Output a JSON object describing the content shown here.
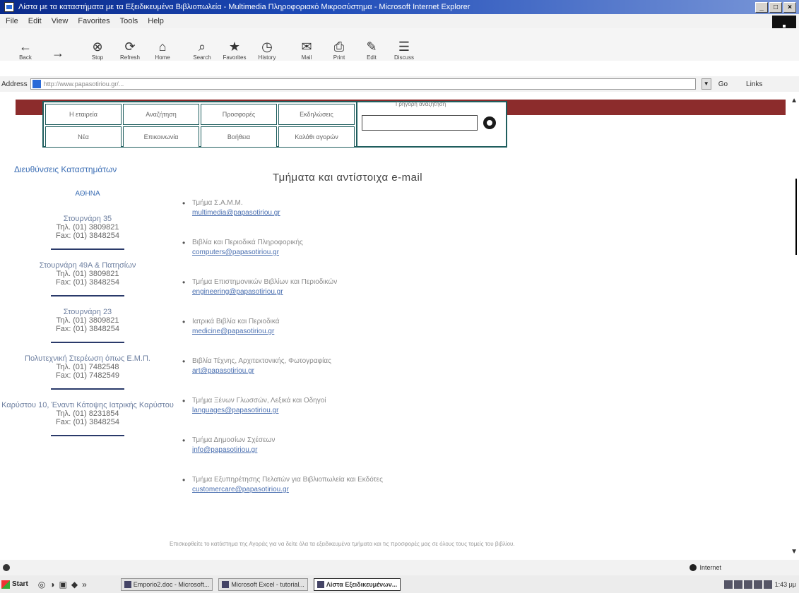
{
  "window": {
    "title": "Λίστα με τα καταστήματα με τα Εξειδικευμένα Βιβλιοπωλεία - Multimedia Πληροφοριακό Μικροσύστημα - Microsoft Internet Explorer",
    "btn_min": "_",
    "btn_max": "□",
    "btn_close": "×"
  },
  "menu": [
    "File",
    "Edit",
    "View",
    "Favorites",
    "Tools",
    "Help"
  ],
  "toolbar": [
    {
      "label": "Back",
      "glyph": "←"
    },
    {
      "label": "",
      "glyph": "→"
    },
    {
      "label": "Stop",
      "glyph": "⊗"
    },
    {
      "label": "Refresh",
      "glyph": "⟳"
    },
    {
      "label": "Home",
      "glyph": "⌂"
    },
    {
      "label": "Search",
      "glyph": "⌕"
    },
    {
      "label": "Favorites",
      "glyph": "★"
    },
    {
      "label": "History",
      "glyph": "◷"
    },
    {
      "label": "Mail",
      "glyph": "✉"
    },
    {
      "label": "Print",
      "glyph": "⎙"
    },
    {
      "label": "Edit",
      "glyph": "✎"
    },
    {
      "label": "Discuss",
      "glyph": "☰"
    }
  ],
  "address": {
    "label": "Address",
    "url": "http://www.papasotiriou.gr/...",
    "go": "Go",
    "links": "Links"
  },
  "nav": {
    "row1": [
      "Η εταιρεία",
      "Αναζήτηση",
      "Προσφορές",
      "Εκδηλώσεις"
    ],
    "row2": [
      "Νέα",
      "Επικοινωνία",
      "Βοήθεια",
      "Καλάθι αγορών"
    ],
    "search_label": "Γρήγορη αναζήτηση"
  },
  "sidebar": {
    "heading": "Διευθύνσεις Καταστημάτων",
    "city": "ΑΘΗΝΑ",
    "stores": [
      {
        "name": "Στουρνάρη 35",
        "tel": "Τηλ. (01) 3809821",
        "fax": "Fax: (01) 3848254"
      },
      {
        "name": "Στουρνάρη 49Α & Πατησίων",
        "tel": "Τηλ. (01) 3809821",
        "fax": "Fax: (01) 3848254"
      },
      {
        "name": "Στουρνάρη 23",
        "tel": "Τηλ. (01) 3809821",
        "fax": "Fax: (01) 3848254"
      },
      {
        "name": "Πολυτεχνική Στερέωση όπως Ε.Μ.Π.",
        "tel": "Τηλ. (01) 7482548",
        "fax": "Fax: (01) 7482549"
      },
      {
        "name": "Καρύστου 10, Έναντι Κάτοψης Ιατρικής Καρύστου",
        "tel": "Τηλ. (01) 8231854",
        "fax": "Fax: (01) 3848254"
      }
    ]
  },
  "main": {
    "heading": "Τμήματα και αντίστοιχα e-mail",
    "items": [
      {
        "dept": "Τμήμα Σ.Α.Μ.Μ.",
        "email": "multimedia@papasotiriou.gr"
      },
      {
        "dept": "Βιβλία και Περιοδικά Πληροφορικής",
        "email": "computers@papasotiriou.gr"
      },
      {
        "dept": "Τμήμα Επιστημονικών Βιβλίων και Περιοδικών",
        "email": "engineering@papasotiriou.gr"
      },
      {
        "dept": "Ιατρικά Βιβλία και Περιοδικά",
        "email": "medicine@papasotiriou.gr"
      },
      {
        "dept": "Βιβλία Τέχνης, Αρχιτεκτονικής, Φωτογραφίας",
        "email": "art@papasotiriou.gr"
      },
      {
        "dept": "Τμήμα Ξένων Γλωσσών, Λεξικά και Οδηγοί",
        "email": "languages@papasotiriou.gr"
      },
      {
        "dept": "Τμήμα Δημοσίων Σχέσεων",
        "email": "info@papasotiriou.gr"
      },
      {
        "dept": "Τμήμα Εξυπηρέτησης Πελατών για Βιβλιοπωλεία και Εκδότες",
        "email": "customercare@papasotiriou.gr"
      }
    ],
    "footer": "Επισκεφθείτε το κατάστημα της Αγοράς για να δείτε όλα τα εξειδικευμένα τμήματα και τις προσφορές μας σε όλους τους τομείς του βιβλίου."
  },
  "status": {
    "zone": "Internet"
  },
  "taskbar": {
    "start": "Start",
    "tasks": [
      {
        "label": "Emporio2.doc - Microsoft..."
      },
      {
        "label": "Microsoft Excel - tutorial..."
      },
      {
        "label": "Λίστα Εξειδικευμένων..."
      }
    ],
    "clock": "1:43 μμ"
  }
}
